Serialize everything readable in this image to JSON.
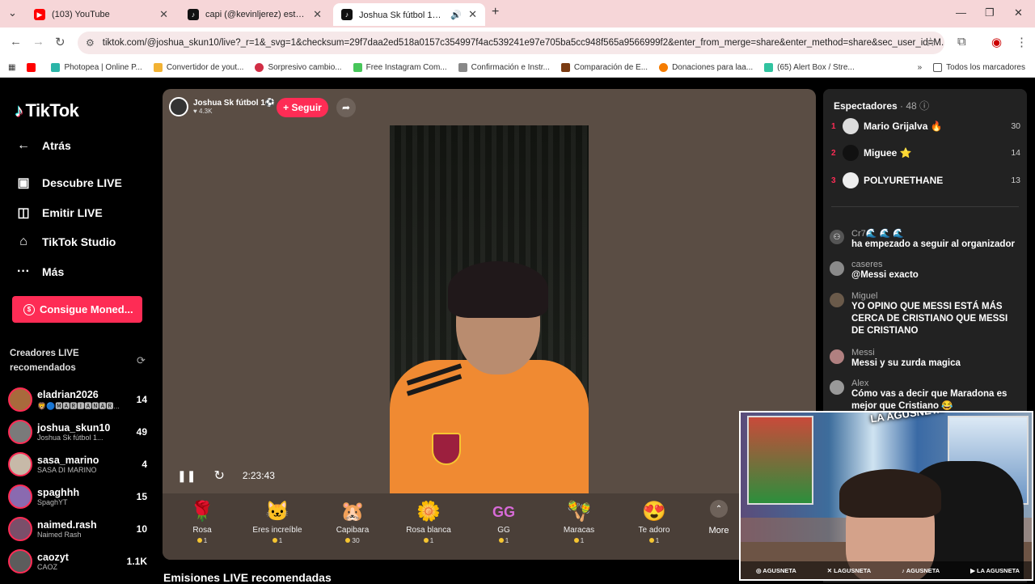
{
  "browser": {
    "tabs": [
      {
        "title": "(103) YouTube",
        "icon": "youtube-icon"
      },
      {
        "title": "capi (@kevinljerez) está emitie",
        "icon": "tiktok-icon"
      },
      {
        "title": "Joshua Sk fútbol 1⚽ (@jo",
        "icon": "tiktok-icon"
      }
    ],
    "url": "tiktok.com/@joshua_skun10/live?_r=1&_svg=1&checksum=29f7daa2ed518a0157c354997f4ac539241e97e705ba5cc948f565a9566999f2&enter_from_merge=share&enter_method=share&sec_user_id=M...",
    "bookmarks": [
      "Photopea | Online P...",
      "Convertidor de yout...",
      "Sorpresivo cambio...",
      "Free Instagram Com...",
      "Confirmación e Instr...",
      "Comparación de E...",
      "Donaciones para laa...",
      "(65) Alert Box / Stre..."
    ],
    "all_bookmarks": "Todos los marcadores"
  },
  "sidebar": {
    "logo": "TikTok",
    "nav": [
      {
        "label": "Atrás",
        "icon": "←"
      },
      {
        "label": "Descubre LIVE",
        "icon": "▣"
      },
      {
        "label": "Emitir LIVE",
        "icon": "◫"
      },
      {
        "label": "TikTok Studio",
        "icon": "⌂"
      },
      {
        "label": "Más",
        "icon": "···"
      }
    ],
    "coins_button": "Consigue Moned...",
    "recommended_title": "Creadores LIVE recomendados",
    "creators": [
      {
        "name": "eladrian2026",
        "sub": "🦁🔵🅼🅰🆁🅸🅰🅽🅰🆁...",
        "count": "14",
        "color": "#a86a3c"
      },
      {
        "name": "joshua_skun10",
        "sub": "Joshua Sk fútbol 1...",
        "count": "49",
        "color": "#7a7a7a"
      },
      {
        "name": "sasa_marino",
        "sub": "SASA DI MARINO",
        "count": "4",
        "color": "#c7b9a8"
      },
      {
        "name": "spaghhh",
        "sub": "SpaghYT",
        "count": "15",
        "color": "#8a6ab0"
      },
      {
        "name": "naimed.rash",
        "sub": "Naimed Rash",
        "count": "10",
        "color": "#7a4f6a"
      },
      {
        "name": "caozyt",
        "sub": "CAOZ",
        "count": "1.1K",
        "color": "#5c5c5c"
      }
    ]
  },
  "live": {
    "host_name": "Joshua Sk fútbol 1⚽",
    "likes": "♥ 4.3K",
    "follow_label": "+ Seguir",
    "elapsed": "2:23:43",
    "gifts": [
      {
        "name": "Rosa",
        "price": "1",
        "icon": "🌹"
      },
      {
        "name": "Eres increíble",
        "price": "1",
        "icon": "🐱"
      },
      {
        "name": "Capibara",
        "price": "30",
        "icon": "🐹"
      },
      {
        "name": "Rosa blanca",
        "price": "1",
        "icon": "🌼"
      },
      {
        "name": "GG",
        "price": "1",
        "icon": "GG"
      },
      {
        "name": "Maracas",
        "price": "1",
        "icon": "🪇"
      },
      {
        "name": "Te adoro",
        "price": "1",
        "icon": "😍"
      }
    ],
    "more_label": "More",
    "recommended_bottom": "Emisiones LIVE recomendadas"
  },
  "chat": {
    "viewers_title": "Espectadores",
    "viewers_count": "· 48",
    "top_viewers": [
      {
        "rank": "1",
        "name": "Mario Grijalva 🔥",
        "score": "30",
        "color": "#ddd"
      },
      {
        "rank": "2",
        "name": "Miguee ⭐",
        "score": "14",
        "color": "#111"
      },
      {
        "rank": "3",
        "name": "POLYURETHANE",
        "score": "13",
        "color": "#eee"
      }
    ],
    "messages": [
      {
        "user": "Cr7🌊 🌊 🌊",
        "text": "ha empezado a seguir al organizador",
        "color": "#555"
      },
      {
        "user": "caseres",
        "text": "@Messi exacto",
        "color": "#8a8a8a"
      },
      {
        "user": "Miguel",
        "text": "YO OPINO QUE MESSI ESTÁ MÁS CERCA DE CRISTIANO QUE MESSI DE CRISTIANO",
        "color": "#6a5a4a"
      },
      {
        "user": "Messi",
        "text": "Messi y su zurda magica",
        "color": "#b08080"
      },
      {
        "user": "Alex",
        "text": "Cómo vas a decir que Maradona es mejor que Cristiano 😂",
        "color": "#999"
      }
    ]
  },
  "cam": {
    "brand": "LA AGUSNETA",
    "socials": [
      "◎ AGUSNETA",
      "✕ LAGUSNETA",
      "♪ AGUSNETA",
      "▶ LA AGUSNETA"
    ]
  }
}
